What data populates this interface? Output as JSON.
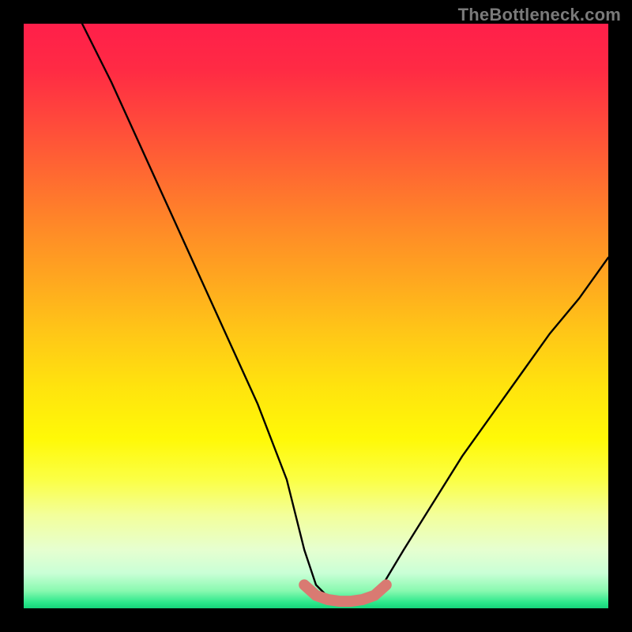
{
  "watermark": "TheBottleneck.com",
  "chart_data": {
    "type": "line",
    "title": "",
    "xlabel": "",
    "ylabel": "",
    "xlim": [
      0,
      100
    ],
    "ylim": [
      0,
      100
    ],
    "legend": false,
    "grid": false,
    "series": [
      {
        "name": "bottleneck-curve",
        "color": "#000000",
        "x": [
          10,
          15,
          20,
          25,
          30,
          35,
          40,
          45,
          48,
          50,
          52,
          55,
          57,
          60,
          62,
          65,
          70,
          75,
          80,
          85,
          90,
          95,
          100
        ],
        "values": [
          100,
          90,
          79,
          68,
          57,
          46,
          35,
          22,
          10,
          4,
          2,
          1,
          1,
          2,
          5,
          10,
          18,
          26,
          33,
          40,
          47,
          53,
          60
        ]
      },
      {
        "name": "optimal-zone-marker",
        "color": "#d97a72",
        "x": [
          48,
          50,
          52,
          54,
          56,
          58,
          60,
          62
        ],
        "values": [
          4,
          2.2,
          1.5,
          1.2,
          1.2,
          1.5,
          2.2,
          4
        ]
      }
    ],
    "background_gradient_stops": [
      {
        "pos": 0,
        "color": "#ff1f4a"
      },
      {
        "pos": 8,
        "color": "#ff2b44"
      },
      {
        "pos": 17,
        "color": "#ff4a3b"
      },
      {
        "pos": 26,
        "color": "#ff6a31"
      },
      {
        "pos": 35,
        "color": "#ff8a27"
      },
      {
        "pos": 44,
        "color": "#ffa81f"
      },
      {
        "pos": 53,
        "color": "#ffc717"
      },
      {
        "pos": 62,
        "color": "#ffe30e"
      },
      {
        "pos": 71,
        "color": "#fff907"
      },
      {
        "pos": 78,
        "color": "#fbff45"
      },
      {
        "pos": 84,
        "color": "#f3ff9a"
      },
      {
        "pos": 90,
        "color": "#e6ffd0"
      },
      {
        "pos": 94,
        "color": "#c9ffd6"
      },
      {
        "pos": 97,
        "color": "#89f9b0"
      },
      {
        "pos": 99,
        "color": "#2ce88b"
      },
      {
        "pos": 100,
        "color": "#16d47a"
      }
    ]
  }
}
